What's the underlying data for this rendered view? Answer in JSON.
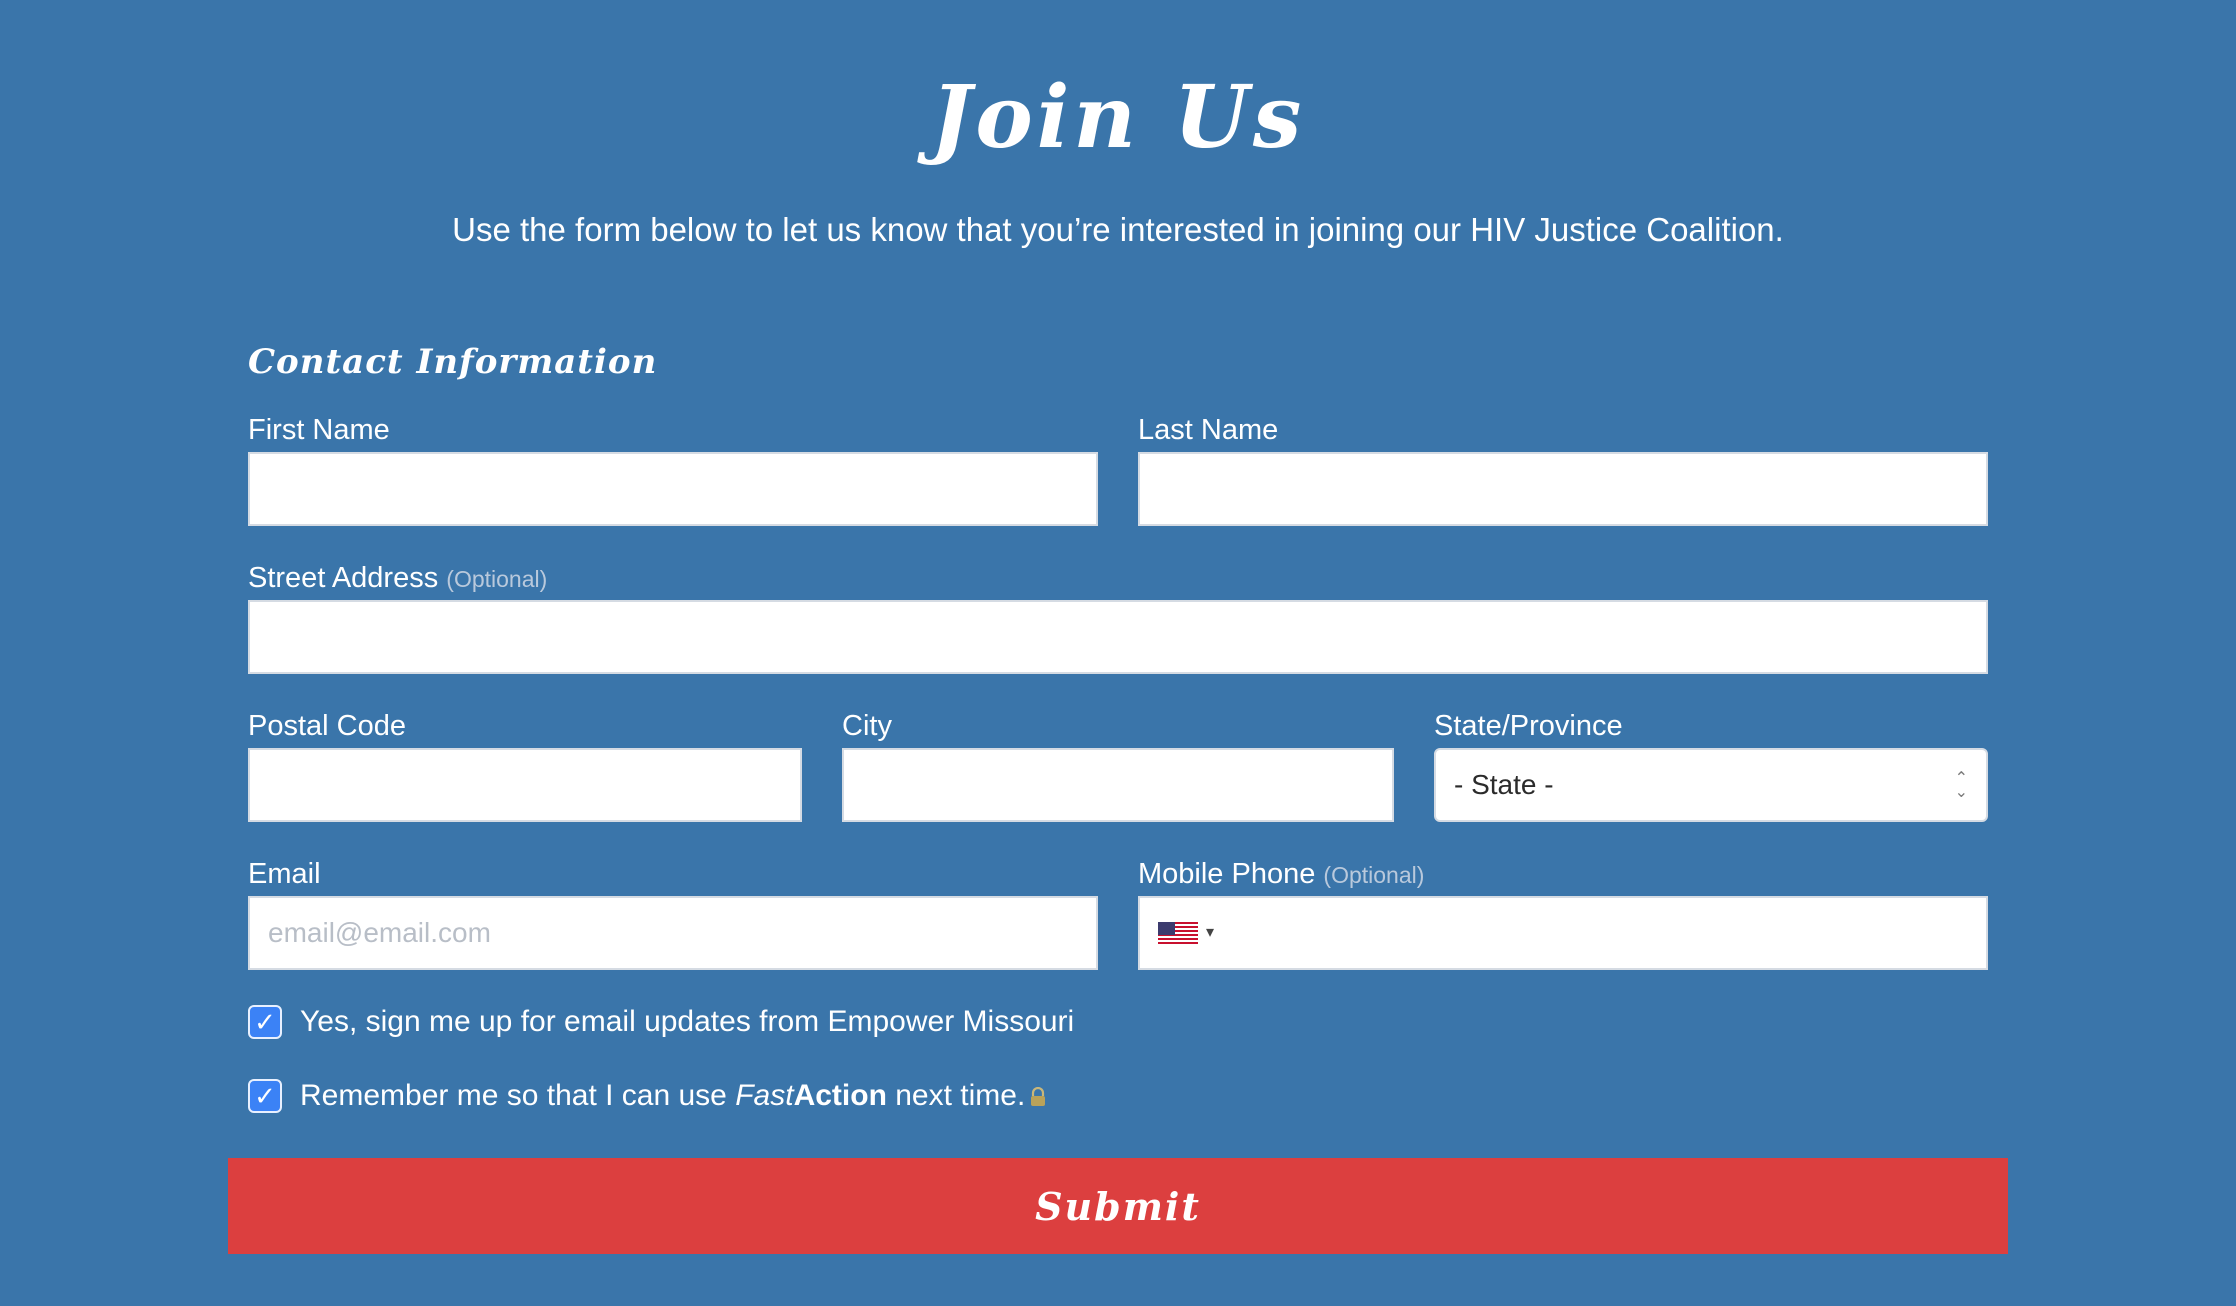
{
  "page": {
    "title": "Join Us",
    "subtitle": "Use the form below to let us know that you’re interested in joining our HIV Justice Coalition."
  },
  "form": {
    "section_heading": "Contact Information",
    "first_name": {
      "label": "First Name",
      "value": ""
    },
    "last_name": {
      "label": "Last Name",
      "value": ""
    },
    "street_address": {
      "label": "Street Address",
      "optional": "(Optional)",
      "value": ""
    },
    "postal_code": {
      "label": "Postal Code",
      "value": ""
    },
    "city": {
      "label": "City",
      "value": ""
    },
    "state": {
      "label": "State/Province",
      "selected": "- State -"
    },
    "email": {
      "label": "Email",
      "placeholder": "email@email.com",
      "value": ""
    },
    "mobile_phone": {
      "label": "Mobile Phone",
      "optional": "(Optional)",
      "value": "",
      "country_flag": "us-flag-icon"
    },
    "checkbox_email_updates": {
      "checked": true,
      "label": "Yes, sign me up for email updates from Empower Missouri"
    },
    "checkbox_remember": {
      "checked": true,
      "label_prefix": "Remember me so that I can use ",
      "label_fast": "Fast",
      "label_action": "Action",
      "label_suffix": " next time."
    },
    "submit_label": "Submit"
  },
  "colors": {
    "background": "#3a75aa",
    "submit": "#dc3f3f",
    "checkbox": "#3b82f6"
  }
}
